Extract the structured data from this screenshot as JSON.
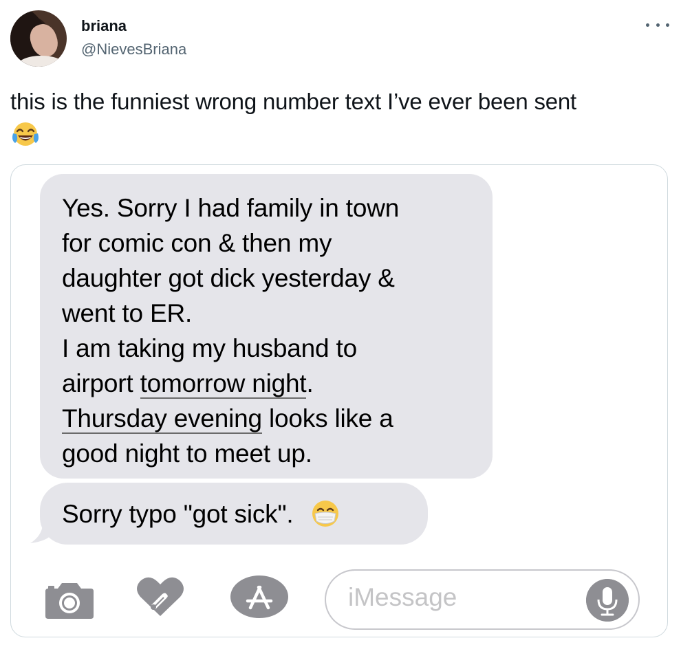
{
  "tweet": {
    "author_name": "briana",
    "author_handle": "@NievesBriana",
    "text": "this is the funniest wrong number text I’ve ever been sent",
    "emoji": "face-with-tears-of-joy"
  },
  "screenshot": {
    "message_lines": [
      "Yes. Sorry I had family in town",
      "for comic con & then my",
      "daughter got dick yesterday &",
      "went to ER.",
      "I am taking my husband to",
      "airport ",
      "tomorrow night",
      ".",
      "Thursday evening",
      " looks like a",
      "good night to meet up."
    ],
    "message2": "Sorry typo \"got sick\".",
    "message2_emoji": "face-with-medical-mask",
    "input_placeholder": "iMessage",
    "toolbar_icons": [
      "camera-icon",
      "digital-touch-heart-icon",
      "app-store-icon",
      "microphone-icon"
    ]
  },
  "colors": {
    "bubble_gray": "#e5e5ea",
    "icon_gray": "#8e8e93",
    "handle_gray": "#536471",
    "border": "#cfd9de"
  }
}
